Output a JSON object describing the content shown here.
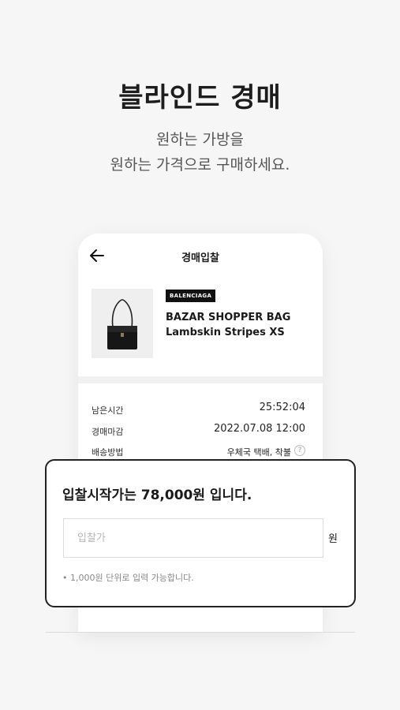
{
  "promo": {
    "headline": "블라인드 경매",
    "sub_line1": "원하는 가방을",
    "sub_line2": "원하는 가격으로 구매하세요."
  },
  "screen": {
    "title": "경매입찰",
    "back_icon": "arrow-left-icon",
    "product": {
      "brand": "BALENCIAGA",
      "name_line1": "BAZAR SHOPPER BAG",
      "name_line2": "Lambskin Stripes XS"
    },
    "info": [
      {
        "label": "남은시간",
        "value": "25:52:04"
      },
      {
        "label": "경매마감",
        "value": "2022.07.08 12:00"
      },
      {
        "label": "배송방법",
        "value": "우체국 택배, 착불"
      }
    ]
  },
  "bid_card": {
    "title": "입찰시작가는 78,000원 입니다.",
    "input_placeholder": "입찰가",
    "unit": "원",
    "note": "• 1,000원 단위로 입력 가능합니다."
  }
}
